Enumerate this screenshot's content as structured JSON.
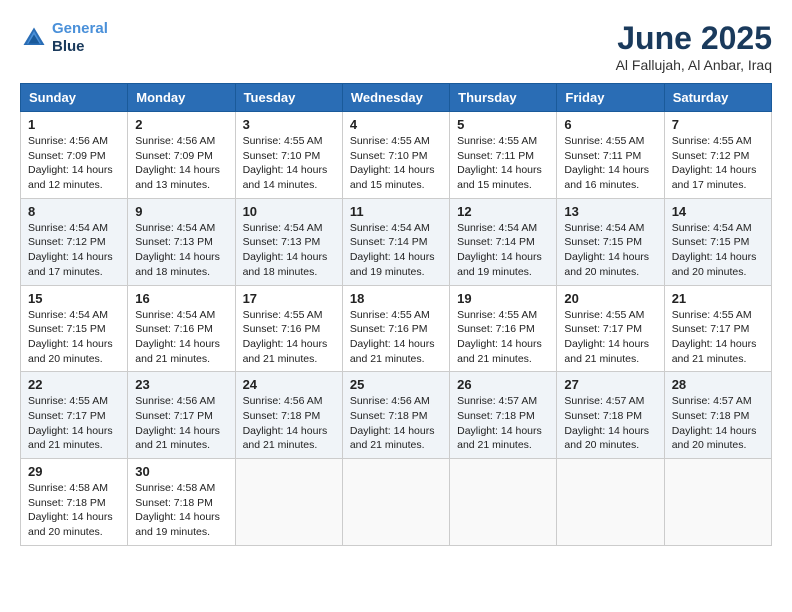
{
  "header": {
    "logo_line1": "General",
    "logo_line2": "Blue",
    "month_year": "June 2025",
    "location": "Al Fallujah, Al Anbar, Iraq"
  },
  "days_of_week": [
    "Sunday",
    "Monday",
    "Tuesday",
    "Wednesday",
    "Thursday",
    "Friday",
    "Saturday"
  ],
  "weeks": [
    [
      {
        "day": "1",
        "sunrise": "4:56 AM",
        "sunset": "7:09 PM",
        "daylight": "14 hours and 12 minutes."
      },
      {
        "day": "2",
        "sunrise": "4:56 AM",
        "sunset": "7:09 PM",
        "daylight": "14 hours and 13 minutes."
      },
      {
        "day": "3",
        "sunrise": "4:55 AM",
        "sunset": "7:10 PM",
        "daylight": "14 hours and 14 minutes."
      },
      {
        "day": "4",
        "sunrise": "4:55 AM",
        "sunset": "7:10 PM",
        "daylight": "14 hours and 15 minutes."
      },
      {
        "day": "5",
        "sunrise": "4:55 AM",
        "sunset": "7:11 PM",
        "daylight": "14 hours and 15 minutes."
      },
      {
        "day": "6",
        "sunrise": "4:55 AM",
        "sunset": "7:11 PM",
        "daylight": "14 hours and 16 minutes."
      },
      {
        "day": "7",
        "sunrise": "4:55 AM",
        "sunset": "7:12 PM",
        "daylight": "14 hours and 17 minutes."
      }
    ],
    [
      {
        "day": "8",
        "sunrise": "4:54 AM",
        "sunset": "7:12 PM",
        "daylight": "14 hours and 17 minutes."
      },
      {
        "day": "9",
        "sunrise": "4:54 AM",
        "sunset": "7:13 PM",
        "daylight": "14 hours and 18 minutes."
      },
      {
        "day": "10",
        "sunrise": "4:54 AM",
        "sunset": "7:13 PM",
        "daylight": "14 hours and 18 minutes."
      },
      {
        "day": "11",
        "sunrise": "4:54 AM",
        "sunset": "7:14 PM",
        "daylight": "14 hours and 19 minutes."
      },
      {
        "day": "12",
        "sunrise": "4:54 AM",
        "sunset": "7:14 PM",
        "daylight": "14 hours and 19 minutes."
      },
      {
        "day": "13",
        "sunrise": "4:54 AM",
        "sunset": "7:15 PM",
        "daylight": "14 hours and 20 minutes."
      },
      {
        "day": "14",
        "sunrise": "4:54 AM",
        "sunset": "7:15 PM",
        "daylight": "14 hours and 20 minutes."
      }
    ],
    [
      {
        "day": "15",
        "sunrise": "4:54 AM",
        "sunset": "7:15 PM",
        "daylight": "14 hours and 20 minutes."
      },
      {
        "day": "16",
        "sunrise": "4:54 AM",
        "sunset": "7:16 PM",
        "daylight": "14 hours and 21 minutes."
      },
      {
        "day": "17",
        "sunrise": "4:55 AM",
        "sunset": "7:16 PM",
        "daylight": "14 hours and 21 minutes."
      },
      {
        "day": "18",
        "sunrise": "4:55 AM",
        "sunset": "7:16 PM",
        "daylight": "14 hours and 21 minutes."
      },
      {
        "day": "19",
        "sunrise": "4:55 AM",
        "sunset": "7:16 PM",
        "daylight": "14 hours and 21 minutes."
      },
      {
        "day": "20",
        "sunrise": "4:55 AM",
        "sunset": "7:17 PM",
        "daylight": "14 hours and 21 minutes."
      },
      {
        "day": "21",
        "sunrise": "4:55 AM",
        "sunset": "7:17 PM",
        "daylight": "14 hours and 21 minutes."
      }
    ],
    [
      {
        "day": "22",
        "sunrise": "4:55 AM",
        "sunset": "7:17 PM",
        "daylight": "14 hours and 21 minutes."
      },
      {
        "day": "23",
        "sunrise": "4:56 AM",
        "sunset": "7:17 PM",
        "daylight": "14 hours and 21 minutes."
      },
      {
        "day": "24",
        "sunrise": "4:56 AM",
        "sunset": "7:18 PM",
        "daylight": "14 hours and 21 minutes."
      },
      {
        "day": "25",
        "sunrise": "4:56 AM",
        "sunset": "7:18 PM",
        "daylight": "14 hours and 21 minutes."
      },
      {
        "day": "26",
        "sunrise": "4:57 AM",
        "sunset": "7:18 PM",
        "daylight": "14 hours and 21 minutes."
      },
      {
        "day": "27",
        "sunrise": "4:57 AM",
        "sunset": "7:18 PM",
        "daylight": "14 hours and 20 minutes."
      },
      {
        "day": "28",
        "sunrise": "4:57 AM",
        "sunset": "7:18 PM",
        "daylight": "14 hours and 20 minutes."
      }
    ],
    [
      {
        "day": "29",
        "sunrise": "4:58 AM",
        "sunset": "7:18 PM",
        "daylight": "14 hours and 20 minutes."
      },
      {
        "day": "30",
        "sunrise": "4:58 AM",
        "sunset": "7:18 PM",
        "daylight": "14 hours and 19 minutes."
      },
      null,
      null,
      null,
      null,
      null
    ]
  ],
  "labels": {
    "sunrise": "Sunrise:",
    "sunset": "Sunset:",
    "daylight": "Daylight:"
  }
}
